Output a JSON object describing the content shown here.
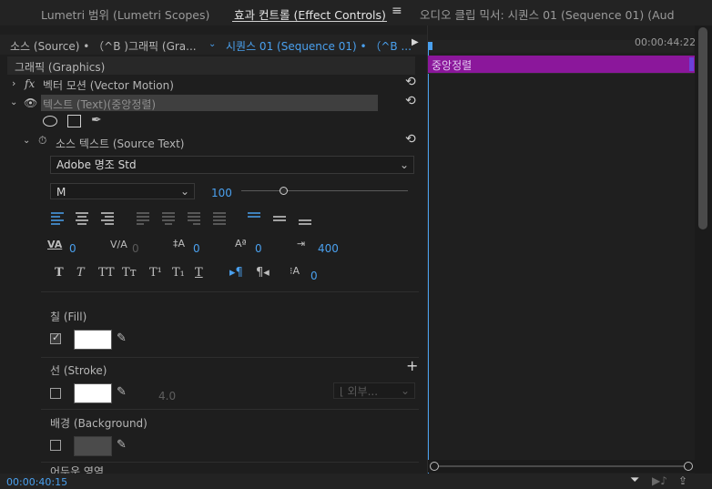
{
  "tabs": {
    "lumetri": "Lumetri 범위 (Lumetri Scopes)",
    "effect_controls": "효과 컨트롤 (Effect Controls)",
    "menu_glyph": "≡",
    "audio_mixer": "오디오 클립 믹서: 시퀀스 01 (Sequence 01) (Aud"
  },
  "header": {
    "source": "소스 (Source) • （^B )그래픽 (Gra...",
    "sequence": "시퀀스 01 (Sequence 01) • （^B ...",
    "play_glyph": "▶"
  },
  "timeline": {
    "timecode": "00:00:44:22",
    "clip_label": "중앙정렬"
  },
  "tree": {
    "graphics": "그래픽 (Graphics)",
    "vector_motion": "벡터 모션 (Vector Motion)",
    "fx_glyph": "fx",
    "text_layer": "텍스트 (Text)(중앙정렬)",
    "source_text": "소스 텍스트 (Source Text)"
  },
  "text_props": {
    "font": "Adobe 명조 Std",
    "style": "M",
    "size": "100",
    "size_slider_fraction": 0.25,
    "kerning": "0",
    "tracking": "0",
    "leading": "0",
    "baseline": "0",
    "tab_width": "400",
    "tsume": "0"
  },
  "fill": {
    "label": "칠 (Fill)",
    "checked": true,
    "color": "#ffffff"
  },
  "stroke": {
    "label": "선 (Stroke)",
    "width": "4.0",
    "position": "외부...",
    "checked": false,
    "color": "#ffffff"
  },
  "background": {
    "label": "배경 (Background)",
    "checked": false
  },
  "shadow": {
    "label": "어두운 영역"
  },
  "status": {
    "current_time": "00:00:40:15"
  }
}
